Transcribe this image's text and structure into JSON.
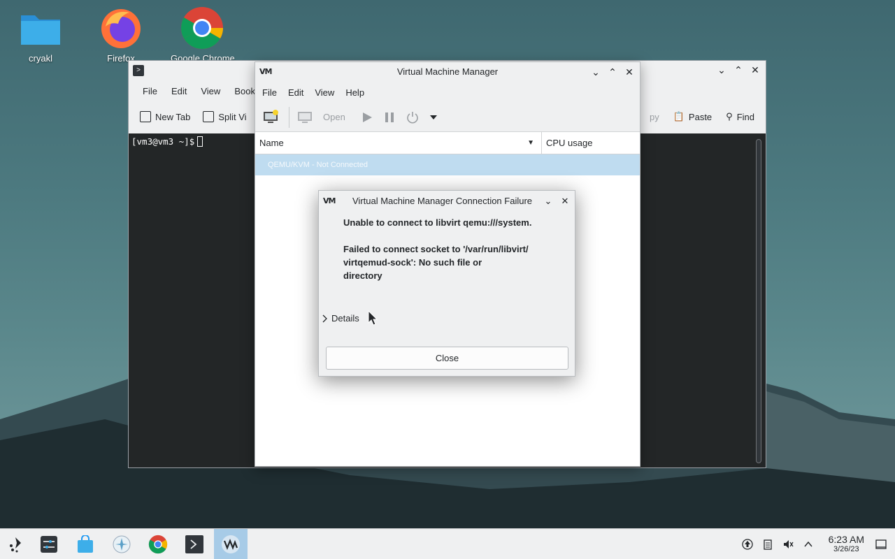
{
  "desktop": {
    "icons": [
      {
        "label": "cryakl"
      },
      {
        "label": "Firefox"
      },
      {
        "label": "Google Chrome"
      }
    ]
  },
  "terminal": {
    "menu": [
      "File",
      "Edit",
      "View",
      "Bookm"
    ],
    "toolbar": {
      "new_tab": "New Tab",
      "split_view": "Split Vi",
      "copy": "py",
      "paste": "Paste",
      "find": "Find"
    },
    "prompt": "[vm3@vm3 ~]$"
  },
  "vmm": {
    "title": "Virtual Machine Manager",
    "menu": [
      "File",
      "Edit",
      "View",
      "Help"
    ],
    "toolbar": {
      "open": "Open"
    },
    "columns": {
      "name": "Name",
      "cpu": "CPU usage"
    },
    "rows": [
      {
        "label": "QEMU/KVM - Not Connected"
      }
    ]
  },
  "dialog": {
    "title": "Virtual Machine Manager Connection Failure",
    "message_line1": "Unable to connect to libvirt qemu:///system.",
    "message_line2": "Failed to connect socket to '/var/run/libvirt/",
    "message_line3": "virtqemud-sock': No such file or",
    "message_line4": "directory",
    "details_label": "Details",
    "close_label": "Close"
  },
  "taskbar": {
    "clock_time": "6:23 AM",
    "clock_date": "3/26/23"
  },
  "logo_text": "VM"
}
